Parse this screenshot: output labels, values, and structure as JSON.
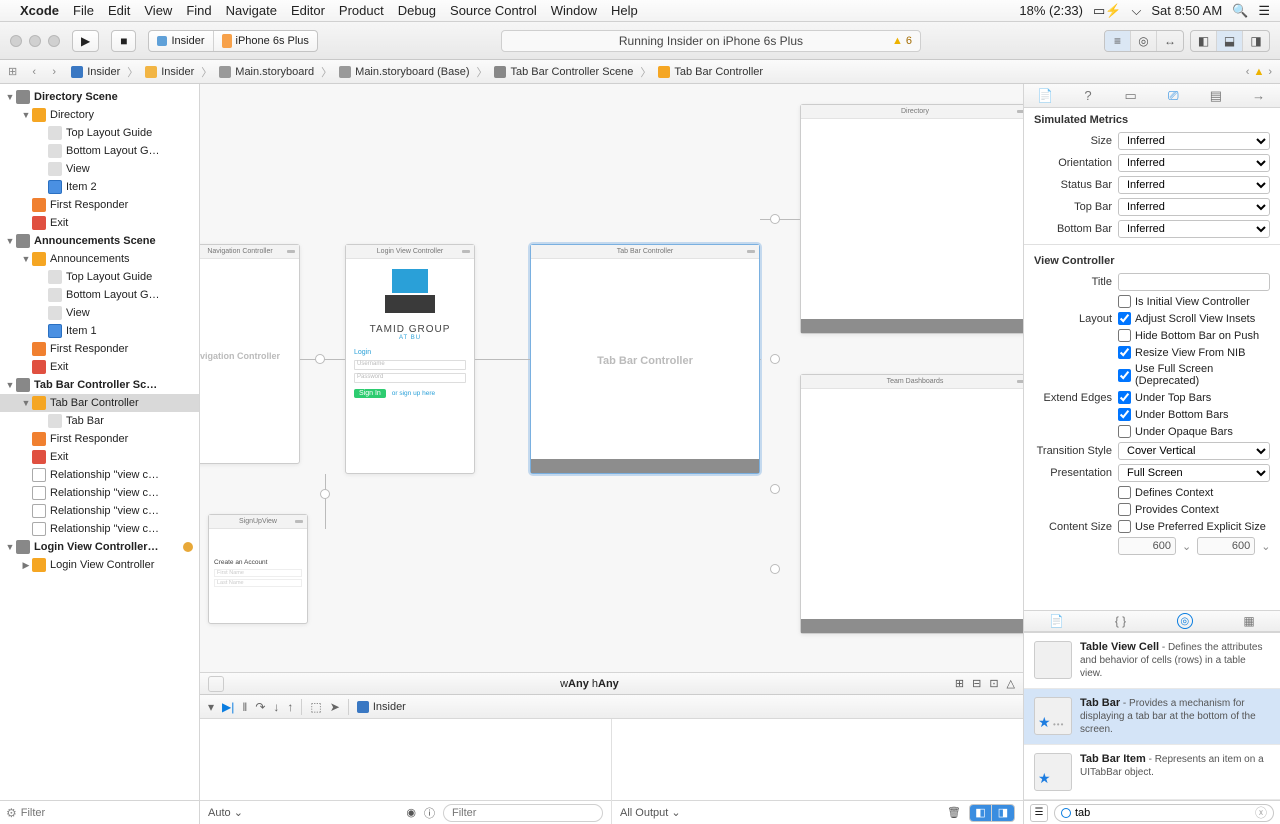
{
  "menubar": {
    "app": "Xcode",
    "items": [
      "File",
      "Edit",
      "View",
      "Find",
      "Navigate",
      "Editor",
      "Product",
      "Debug",
      "Source Control",
      "Window",
      "Help"
    ],
    "battery": "18% (2:33)",
    "clock": "Sat 8:50 AM"
  },
  "toolbar": {
    "scheme_target": "Insider",
    "scheme_device": "iPhone 6s Plus",
    "activity": "Running Insider on iPhone 6s Plus",
    "warning_count": "6"
  },
  "jumpbar": {
    "items": [
      "Insider",
      "Insider",
      "Main.storyboard",
      "Main.storyboard (Base)",
      "Tab Bar Controller Scene",
      "Tab Bar Controller"
    ]
  },
  "navigator": {
    "filter_placeholder": "Filter",
    "tree": [
      {
        "d": 0,
        "disc": "▼",
        "icon": "ic-scene-g",
        "label": "Directory Scene",
        "bold": true
      },
      {
        "d": 1,
        "disc": "▼",
        "icon": "ic-folder-o",
        "label": "Directory"
      },
      {
        "d": 2,
        "disc": "",
        "icon": "ic-layout",
        "label": "Top Layout Guide"
      },
      {
        "d": 2,
        "disc": "",
        "icon": "ic-layout",
        "label": "Bottom Layout G…"
      },
      {
        "d": 2,
        "disc": "",
        "icon": "ic-view",
        "label": "View"
      },
      {
        "d": 2,
        "disc": "",
        "icon": "ic-item",
        "label": "Item 2"
      },
      {
        "d": 1,
        "disc": "",
        "icon": "ic-first",
        "label": "First Responder"
      },
      {
        "d": 1,
        "disc": "",
        "icon": "ic-exit",
        "label": "Exit"
      },
      {
        "d": 0,
        "disc": "▼",
        "icon": "ic-scene-g",
        "label": "Announcements Scene",
        "bold": true
      },
      {
        "d": 1,
        "disc": "▼",
        "icon": "ic-folder-o",
        "label": "Announcements"
      },
      {
        "d": 2,
        "disc": "",
        "icon": "ic-layout",
        "label": "Top Layout Guide"
      },
      {
        "d": 2,
        "disc": "",
        "icon": "ic-layout",
        "label": "Bottom Layout G…"
      },
      {
        "d": 2,
        "disc": "",
        "icon": "ic-view",
        "label": "View"
      },
      {
        "d": 2,
        "disc": "",
        "icon": "ic-item",
        "label": "Item 1"
      },
      {
        "d": 1,
        "disc": "",
        "icon": "ic-first",
        "label": "First Responder"
      },
      {
        "d": 1,
        "disc": "",
        "icon": "ic-exit",
        "label": "Exit"
      },
      {
        "d": 0,
        "disc": "▼",
        "icon": "ic-scene-g",
        "label": "Tab Bar Controller Sc…",
        "bold": true
      },
      {
        "d": 1,
        "disc": "▼",
        "icon": "ic-folder-o",
        "label": "Tab Bar Controller",
        "sel": true
      },
      {
        "d": 2,
        "disc": "",
        "icon": "ic-view",
        "label": "Tab Bar"
      },
      {
        "d": 1,
        "disc": "",
        "icon": "ic-first",
        "label": "First Responder"
      },
      {
        "d": 1,
        "disc": "",
        "icon": "ic-exit",
        "label": "Exit"
      },
      {
        "d": 1,
        "disc": "",
        "icon": "ic-rel",
        "label": "Relationship \"view c…"
      },
      {
        "d": 1,
        "disc": "",
        "icon": "ic-rel",
        "label": "Relationship \"view c…"
      },
      {
        "d": 1,
        "disc": "",
        "icon": "ic-rel",
        "label": "Relationship \"view c…"
      },
      {
        "d": 1,
        "disc": "",
        "icon": "ic-rel",
        "label": "Relationship \"view c…"
      },
      {
        "d": 0,
        "disc": "▼",
        "icon": "ic-scene-g",
        "label": "Login View Controller…",
        "bold": true,
        "status": true
      },
      {
        "d": 1,
        "disc": "▶",
        "icon": "ic-folder-o",
        "label": "Login View Controller"
      }
    ]
  },
  "canvas": {
    "nav_ctrl": "Navigation Controller",
    "nav_body": "vigation Controller",
    "login": {
      "title": "Login View Controller",
      "brand": "TAMID GROUP",
      "sub": "AT BU",
      "header": "Login",
      "ph_user": "Username",
      "ph_pass": "Password",
      "signin": "Sign In",
      "alt": "or sign up here"
    },
    "tabbar": {
      "title": "Tab Bar Controller",
      "body": "Tab Bar Controller"
    },
    "signup": {
      "title": "SignUpView",
      "h": "Create an Account",
      "f1": "First Name",
      "f2": "Last Name"
    },
    "directory": "Directory",
    "team": "Team Dashboards",
    "sizeclass_w": "Any",
    "sizeclass_h": "Any"
  },
  "debug": {
    "process": "Insider",
    "auto": "Auto",
    "filter_placeholder": "Filter",
    "output": "All Output"
  },
  "inspector": {
    "sections": {
      "sim_metrics": "Simulated Metrics",
      "view_ctrl": "View Controller"
    },
    "sim": {
      "size_l": "Size",
      "size": "Inferred",
      "orient_l": "Orientation",
      "orient": "Inferred",
      "status_l": "Status Bar",
      "status": "Inferred",
      "top_l": "Top Bar",
      "top": "Inferred",
      "bottom_l": "Bottom Bar",
      "bottom": "Inferred"
    },
    "vc": {
      "title_l": "Title",
      "title": "",
      "is_initial": "Is Initial View Controller",
      "layout_l": "Layout",
      "adjust": "Adjust Scroll View Insets",
      "hide_bottom": "Hide Bottom Bar on Push",
      "resize": "Resize View From NIB",
      "fullscreen": "Use Full Screen (Deprecated)",
      "extend_l": "Extend Edges",
      "under_top": "Under Top Bars",
      "under_bottom": "Under Bottom Bars",
      "under_opaque": "Under Opaque Bars",
      "trans_l": "Transition Style",
      "trans": "Cover Vertical",
      "pres_l": "Presentation",
      "pres": "Full Screen",
      "defines": "Defines Context",
      "provides": "Provides Context",
      "csize_l": "Content Size",
      "use_pref": "Use Preferred Explicit Size",
      "w": "600",
      "h": "600"
    },
    "library": {
      "items": [
        {
          "title": "Table View Cell",
          "desc": " - Defines the attributes and behavior of cells (rows) in a table view.",
          "star": false
        },
        {
          "title": "Tab Bar",
          "desc": " - Provides a mechanism for displaying a tab bar at the bottom of the screen.",
          "sel": true,
          "star": true,
          "dots": true
        },
        {
          "title": "Tab Bar Item",
          "desc": " - Represents an item on a UITabBar object.",
          "star": true
        }
      ],
      "filter": "tab"
    }
  }
}
